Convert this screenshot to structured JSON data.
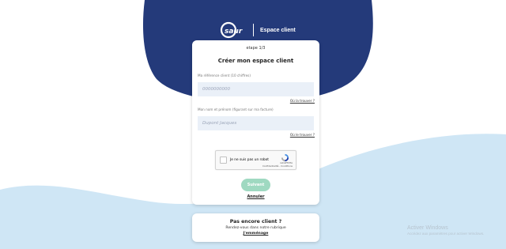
{
  "brand": {
    "logo_text": "saur",
    "section": "Espace client"
  },
  "form": {
    "step": "etape 1/3",
    "title": "Créer mon espace client",
    "reference_label": "Ma référence client (10 chiffres)",
    "reference_placeholder": "0000000000",
    "reference_help": "Où la trouver ?",
    "name_label": "Mon nom et prénom (figurant sur ma facture)",
    "name_placeholder": "Dupont Jacques",
    "name_help": "Où le trouver ?",
    "recaptcha_label": "Je ne suis pas un robot",
    "recaptcha_brand": "reCAPTCHA",
    "recaptcha_terms": "Confidentialité - Conditions",
    "next_button": "Suivant",
    "cancel_link": "Annuler"
  },
  "not_client": {
    "title": "Pas encore client ?",
    "subtitle": "Rendez-vous dans notre rubrique",
    "link": "J'emménage"
  },
  "windows_watermark": {
    "title": "Activer Windows",
    "subtitle": "Accédez aux paramètres pour activer Windows."
  },
  "colors": {
    "navy": "#243a7a",
    "light_blue": "#c9e3f3",
    "accent_green": "#9fd9c1"
  }
}
